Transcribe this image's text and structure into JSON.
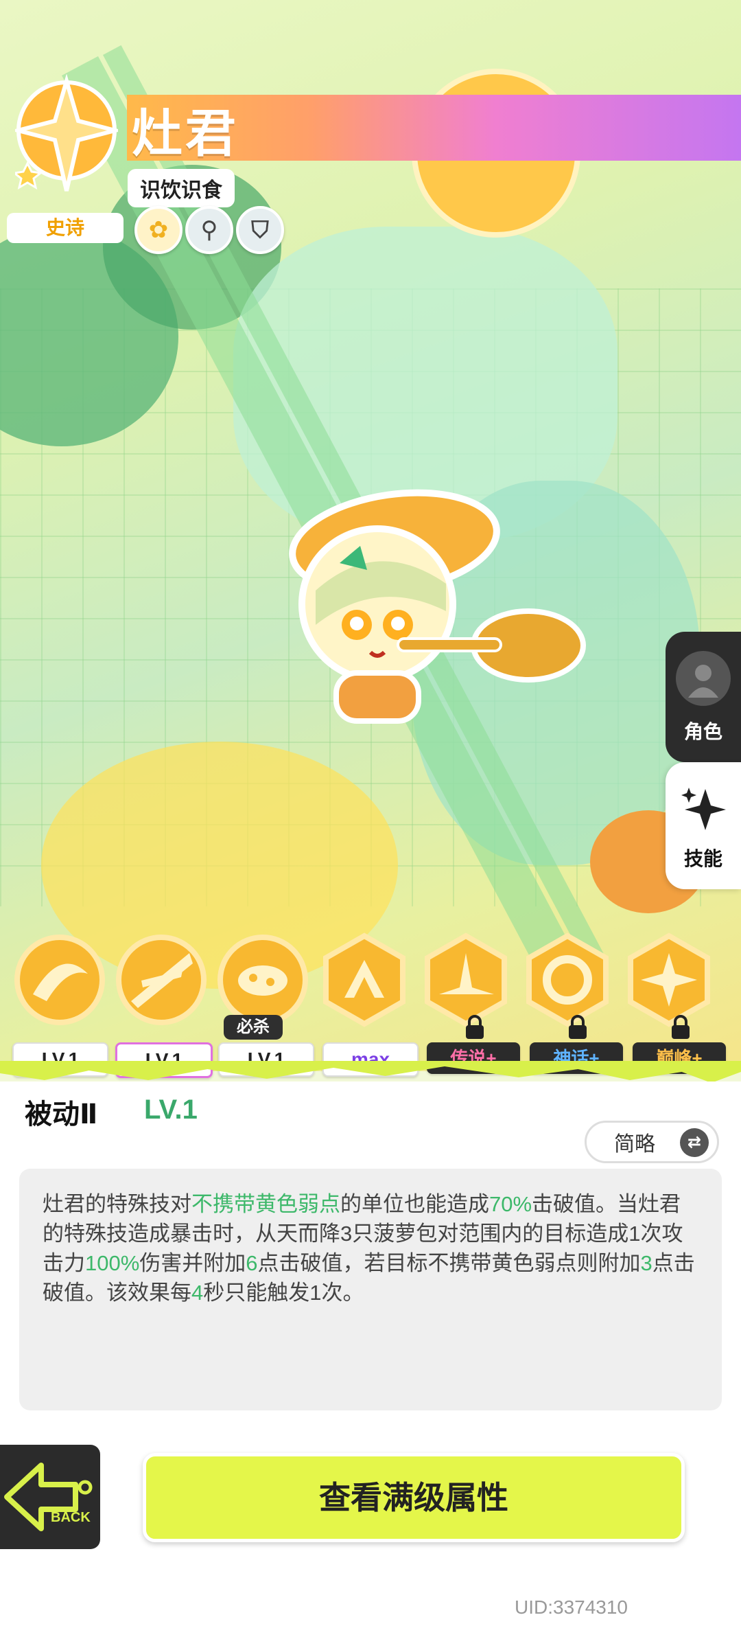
{
  "character": {
    "name": "灶君",
    "subtitle": "识饮识食",
    "rarity": "史诗",
    "tag_icons": [
      "flower-icon",
      "key-icon",
      "shield-claw-icon"
    ]
  },
  "side_tabs": {
    "role_label": "角色",
    "skill_label": "技能"
  },
  "skills": {
    "ult_badge": "必杀",
    "levels": [
      "LV.1",
      "LV.1",
      "LV.1",
      "max",
      "传说+",
      "神话+",
      "巅峰+"
    ],
    "level_colors": [
      "#222222",
      "#222222",
      "#222222",
      "#7b3fe4",
      "#ff6fa8",
      "#5fb3ff",
      "#ffc04a"
    ]
  },
  "detail": {
    "title": "被动Ⅱ",
    "level": "LV.1",
    "toggle_label": "简略",
    "desc": {
      "s1": "灶君的特殊技对",
      "h1": "不携带黄色弱点",
      "s2": "的单位也能造成",
      "h2": "70%",
      "s3": "击破值。当灶君的特殊技造成暴击时，从天而降3只菠萝包对范围内的目标造成1次攻击力",
      "h3": "100%",
      "s4": "伤害并附加",
      "h4": "6",
      "s5": "点击破值，若目标不携带黄色弱点则附加",
      "h5": "3",
      "s6": "点击破值。该效果每",
      "h6": "4",
      "s7": "秒只能触发1次。"
    }
  },
  "buttons": {
    "back_label": "BACK",
    "main_label": "查看满级属性"
  },
  "uid": "UID:3374310",
  "colors": {
    "accent_green": "#3db86a",
    "button_yellow": "#e4f64a",
    "rarity_orange": "#f0a000"
  }
}
